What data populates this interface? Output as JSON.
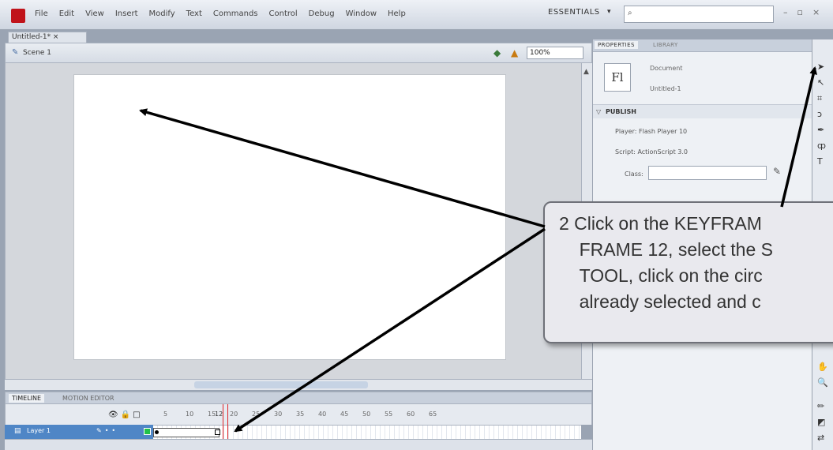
{
  "menubar": {
    "items": [
      "File",
      "Edit",
      "View",
      "Insert",
      "Modify",
      "Text",
      "Commands",
      "Control",
      "Debug",
      "Window",
      "Help"
    ],
    "workspace": "ESSENTIALS",
    "workspace_chevron": "▾",
    "search_value": ""
  },
  "window_controls": [
    "–",
    "▫",
    "×"
  ],
  "document": {
    "tab_label": "Untitled-1* ×",
    "scene_label": "Scene 1",
    "zoom": "100%"
  },
  "timeline": {
    "tabs": [
      "TIMELINE",
      "MOTION EDITOR"
    ],
    "layer_name": "Layer 1",
    "frame_numbers": [
      "5",
      "10",
      "15",
      "20",
      "25",
      "30",
      "35",
      "40",
      "45",
      "50",
      "55",
      "60",
      "65"
    ],
    "current_frame": "12",
    "keyframe_end": 12
  },
  "properties": {
    "tabs": [
      "PROPERTIES",
      "LIBRARY"
    ],
    "doc_type": "Document",
    "doc_name": "Untitled-1",
    "doc_icon_text": "Fl",
    "publish_label": "PUBLISH",
    "player": "Player: Flash Player 10",
    "script": "Script: ActionScript 3.0",
    "class_label": "Class:",
    "class_value": ""
  },
  "callout": {
    "text": "2 Click on the KEYFRAM\n    FRAME 12, select the S\n    TOOL, click on the circ\n    already selected and c"
  },
  "colors": {
    "layer_highlight": "#4f86c6",
    "playhead": "#e0262b",
    "app_red": "#c0131a"
  }
}
